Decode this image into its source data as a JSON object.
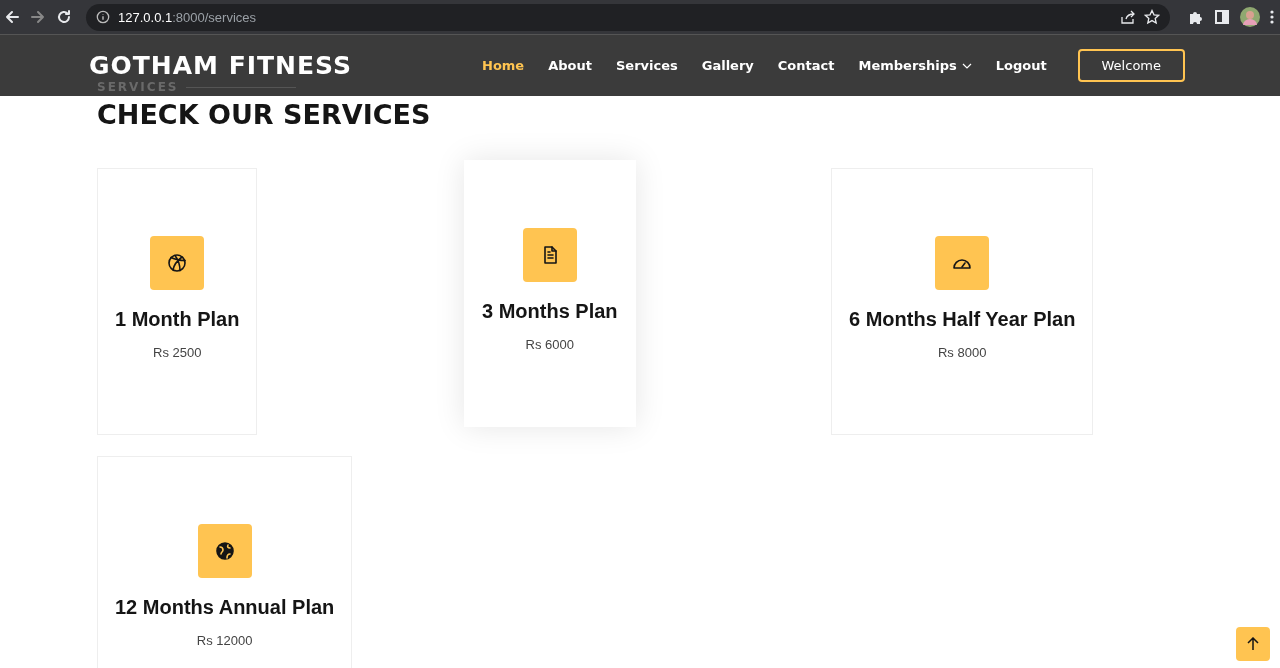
{
  "browser": {
    "url_host": "127.0.0.1",
    "url_rest": ":8000/services"
  },
  "header": {
    "brand": "GOTHAM FITNESS",
    "nav": [
      {
        "label": "Home",
        "selected": true,
        "dropdown": false
      },
      {
        "label": "About",
        "selected": false,
        "dropdown": false
      },
      {
        "label": "Services",
        "selected": false,
        "dropdown": false
      },
      {
        "label": "Gallery",
        "selected": false,
        "dropdown": false
      },
      {
        "label": "Contact",
        "selected": false,
        "dropdown": false
      },
      {
        "label": "Memberships",
        "selected": false,
        "dropdown": true
      },
      {
        "label": "Logout",
        "selected": false,
        "dropdown": false
      }
    ],
    "button": "Welcome"
  },
  "section": {
    "label": "SERVICES",
    "heading": "CHECK OUR SERVICES"
  },
  "plans": [
    {
      "kind": "ball",
      "title": "1 Month Plan",
      "price": "Rs 2500",
      "raised": false
    },
    {
      "kind": "document",
      "title": "3 Months Plan",
      "price": "Rs 6000",
      "raised": true
    },
    {
      "kind": "gauge",
      "title": "6 Months Half Year Plan",
      "price": "Rs 8000",
      "raised": false
    },
    {
      "kind": "globe",
      "title": "12 Months Annual Plan",
      "price": "Rs 12000",
      "raised": false
    }
  ]
}
